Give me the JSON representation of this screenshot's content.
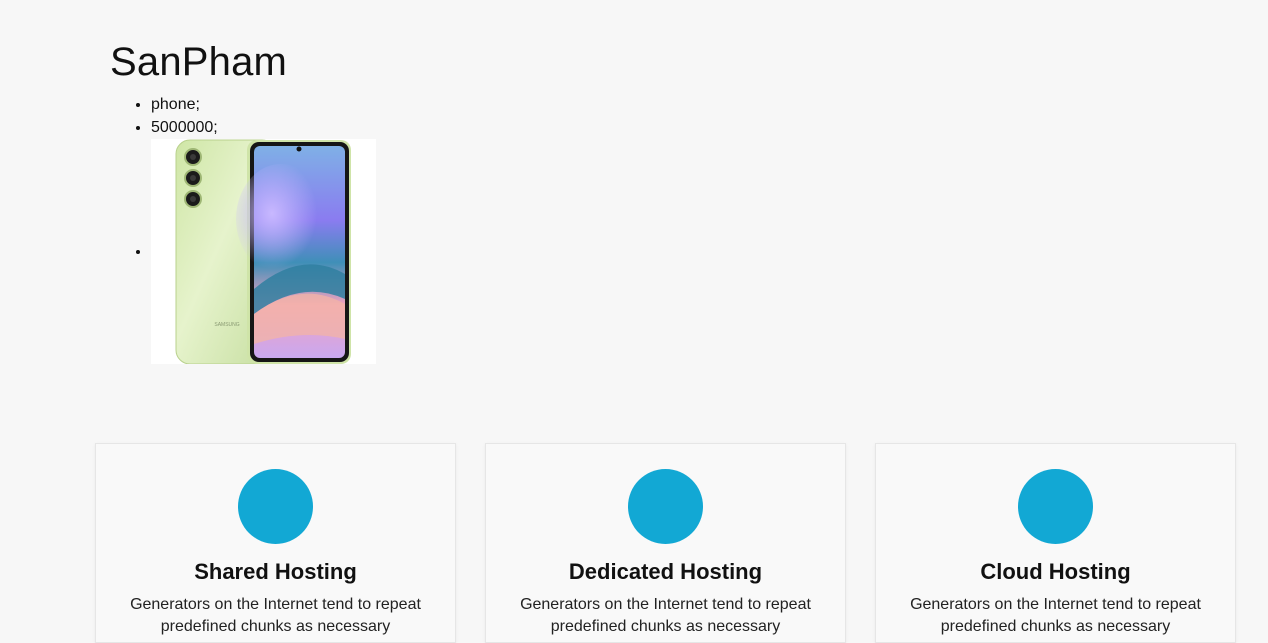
{
  "page": {
    "title": "SanPham"
  },
  "product": {
    "name": "phone;",
    "price": "5000000;",
    "image_alt": "phone",
    "brand_mark": "SAMSUNG"
  },
  "cards": [
    {
      "title": "Shared Hosting",
      "text": "Generators on the Internet tend to repeat predefined chunks as necessary"
    },
    {
      "title": "Dedicated Hosting",
      "text": "Generators on the Internet tend to repeat predefined chunks as necessary"
    },
    {
      "title": "Cloud Hosting",
      "text": "Generators on the Internet tend to repeat predefined chunks as necessary"
    }
  ],
  "colors": {
    "background": "#f7f7f7",
    "card_icon": "#12a8d4",
    "phone_body": "#d8ecb8",
    "phone_bezel": "#1a1a1a"
  }
}
